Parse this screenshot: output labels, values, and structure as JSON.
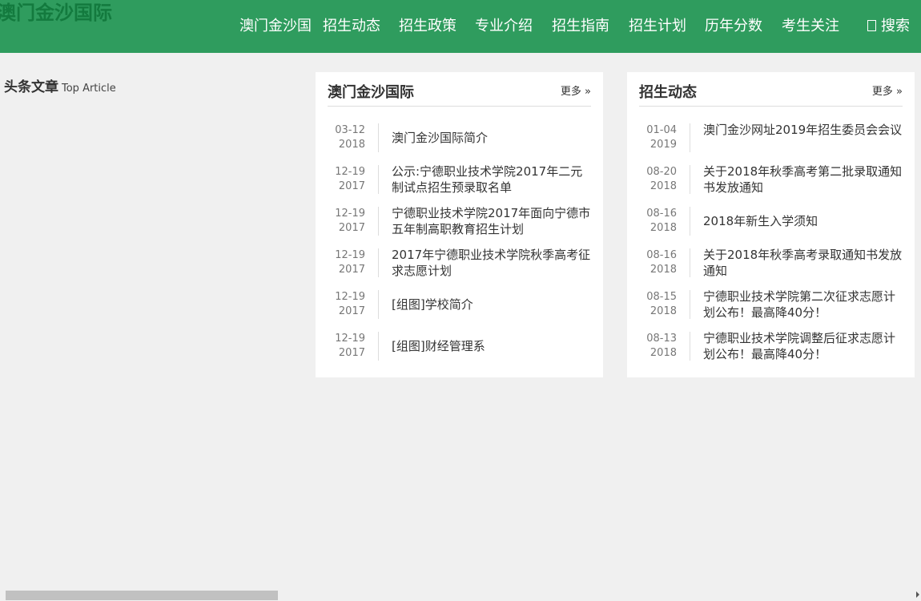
{
  "brand": {
    "logo_text": "澳门金沙国际"
  },
  "nav": {
    "items": [
      "澳门金沙国",
      "招生动态",
      "招生政策",
      "专业介绍",
      "招生指南",
      "招生计划",
      "历年分数",
      "考生关注"
    ],
    "search_label": "搜索"
  },
  "headline": {
    "title_cn": "头条文章",
    "title_en": "Top Article"
  },
  "panels": [
    {
      "title": "澳门金沙国际",
      "more": "更多 »",
      "items": [
        {
          "md": "03-12",
          "year": "2018",
          "text": "澳门金沙国际简介"
        },
        {
          "md": "12-19",
          "year": "2017",
          "text": "公示:宁德职业技术学院2017年二元制试点招生预录取名单"
        },
        {
          "md": "12-19",
          "year": "2017",
          "text": "宁德职业技术学院2017年面向宁德市五年制高职教育招生计划"
        },
        {
          "md": "12-19",
          "year": "2017",
          "text": "2017年宁德职业技术学院秋季高考征求志愿计划"
        },
        {
          "md": "12-19",
          "year": "2017",
          "text": "[组图]学校简介"
        },
        {
          "md": "12-19",
          "year": "2017",
          "text": "[组图]财经管理系"
        }
      ]
    },
    {
      "title": "招生动态",
      "more": "更多 »",
      "items": [
        {
          "md": "01-04",
          "year": "2019",
          "text": "澳门金沙网址2019年招生委员会会议"
        },
        {
          "md": "08-20",
          "year": "2018",
          "text": "关于2018年秋季高考第二批录取通知书发放通知"
        },
        {
          "md": "08-16",
          "year": "2018",
          "text": "2018年新生入学须知"
        },
        {
          "md": "08-16",
          "year": "2018",
          "text": "关于2018年秋季高考录取通知书发放通知"
        },
        {
          "md": "08-15",
          "year": "2018",
          "text": "宁德职业技术学院第二次征求志愿计划公布！最高降40分！"
        },
        {
          "md": "08-13",
          "year": "2018",
          "text": "宁德职业技术学院调整后征求志愿计划公布！最高降40分！"
        }
      ]
    }
  ],
  "colors": {
    "header_bg": "#2f9c5e",
    "logo": "#137a3e"
  }
}
